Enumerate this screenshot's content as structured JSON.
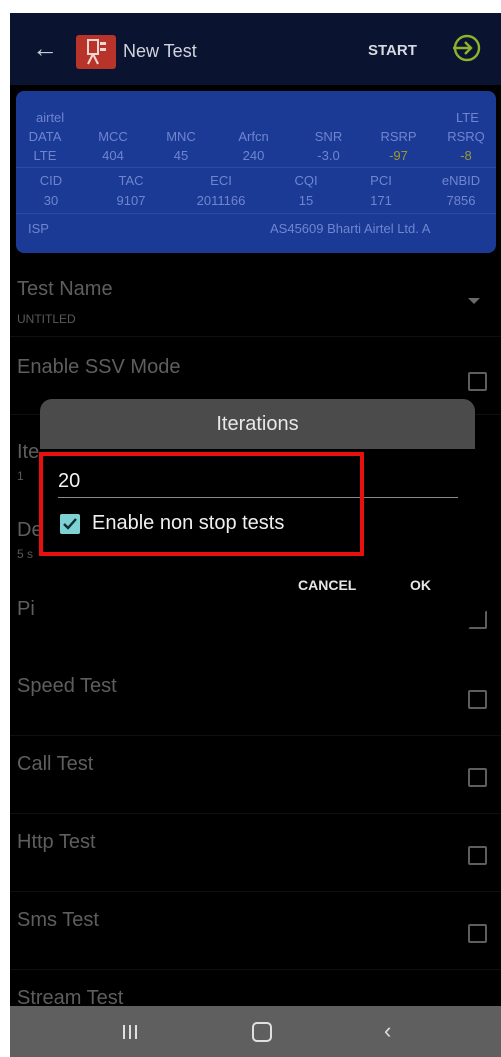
{
  "appbar": {
    "title": "New Test",
    "start_label": "START",
    "back_icon": "arrow-left-icon",
    "start_icon": "circle-arrow-right-icon"
  },
  "network_info": {
    "operator": "airtel",
    "tech": "LTE",
    "headers1": [
      "DATA",
      "MCC",
      "MNC",
      "Arfcn",
      "SNR",
      "RSRP",
      "RSRQ"
    ],
    "values1": [
      "LTE",
      "404",
      "45",
      "240",
      "-3.0",
      "-97",
      "-8"
    ],
    "headers2": [
      "CID",
      "TAC",
      "ECI",
      "CQI",
      "PCI",
      "eNBID"
    ],
    "values2": [
      "30",
      "9107",
      "2011166",
      "15",
      "171",
      "7856"
    ],
    "isp_label": "ISP",
    "isp_value": "AS45609 Bharti Airtel Ltd. A"
  },
  "list": {
    "test_name_label": "Test Name",
    "test_name_value": "UNTITLED",
    "ssv_label": "Enable SSV Mode",
    "iterations_partial": "Ite",
    "iterations_value_partial": "1",
    "delay_partial": "De",
    "delay_value_partial": "5 s",
    "ping_partial": "Pi",
    "speed_test": "Speed Test",
    "call_test": "Call Test",
    "http_test": "Http Test",
    "sms_test": "Sms Test",
    "stream_test": "Stream Test"
  },
  "dialog": {
    "title": "Iterations",
    "input_value": "20",
    "nonstop_label": "Enable non stop tests",
    "nonstop_checked": true,
    "cancel_label": "CANCEL",
    "ok_label": "OK"
  },
  "colors": {
    "appbar_bg": "#0a1430",
    "info_bg": "#1a3a96",
    "checkbox_accent": "#7fd2d4",
    "highlight_border": "#e6100e"
  }
}
